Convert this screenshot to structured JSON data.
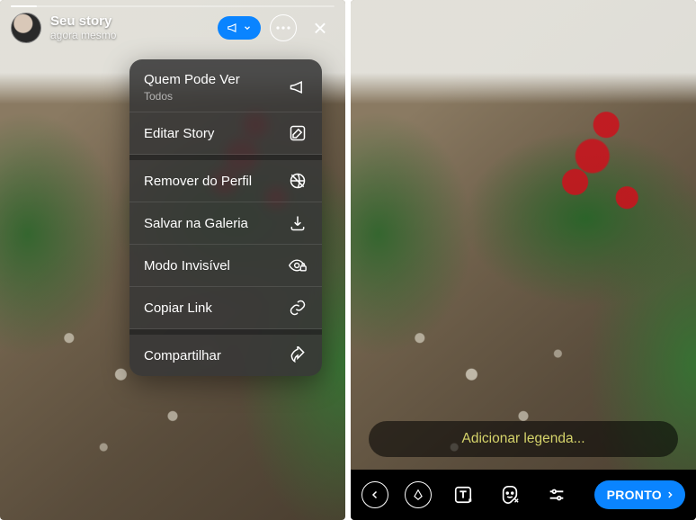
{
  "left": {
    "story_title": "Seu story",
    "story_time": "agora mesmo",
    "menu": {
      "who_can_see": {
        "label": "Quem Pode Ver",
        "sub": "Todos"
      },
      "edit_story": "Editar Story",
      "remove_profile": "Remover do Perfil",
      "save_gallery": "Salvar na Galeria",
      "invisible_mode": "Modo Invisível",
      "copy_link": "Copiar Link",
      "share": "Compartilhar"
    }
  },
  "right": {
    "caption_placeholder": "Adicionar legenda...",
    "done_label": "PRONTO"
  }
}
